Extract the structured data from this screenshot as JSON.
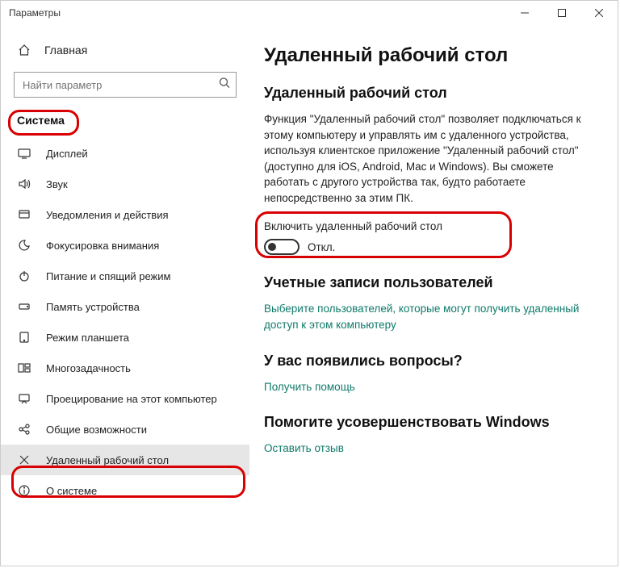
{
  "window": {
    "title": "Параметры"
  },
  "sidebar": {
    "home": "Главная",
    "search_placeholder": "Найти параметр",
    "category": "Система",
    "items": [
      {
        "label": "Дисплей"
      },
      {
        "label": "Звук"
      },
      {
        "label": "Уведомления и действия"
      },
      {
        "label": "Фокусировка внимания"
      },
      {
        "label": "Питание и спящий режим"
      },
      {
        "label": "Память устройства"
      },
      {
        "label": "Режим планшета"
      },
      {
        "label": "Многозадачность"
      },
      {
        "label": "Проецирование на этот компьютер"
      },
      {
        "label": "Общие возможности"
      },
      {
        "label": "Удаленный рабочий стол"
      },
      {
        "label": "О системе"
      }
    ]
  },
  "main": {
    "heading": "Удаленный рабочий стол",
    "subheading": "Удаленный рабочий стол",
    "description": "Функция \"Удаленный рабочий стол\" позволяет подключаться к этому компьютеру и управлять им с удаленного устройства, используя клиентское приложение \"Удаленный рабочий стол\" (доступно для iOS, Android, Mac и Windows). Вы сможете работать с другого устройства так, будто работаете непосредственно за этим ПК.",
    "enable_label": "Включить удаленный рабочий стол",
    "toggle_state": "Откл.",
    "accounts_heading": "Учетные записи пользователей",
    "accounts_link": "Выберите пользователей, которые могут получить удаленный доступ к этом компьютеру",
    "questions_heading": "У вас появились вопросы?",
    "help_link": "Получить помощь",
    "improve_heading": "Помогите усовершенствовать Windows",
    "feedback_link": "Оставить отзыв"
  }
}
